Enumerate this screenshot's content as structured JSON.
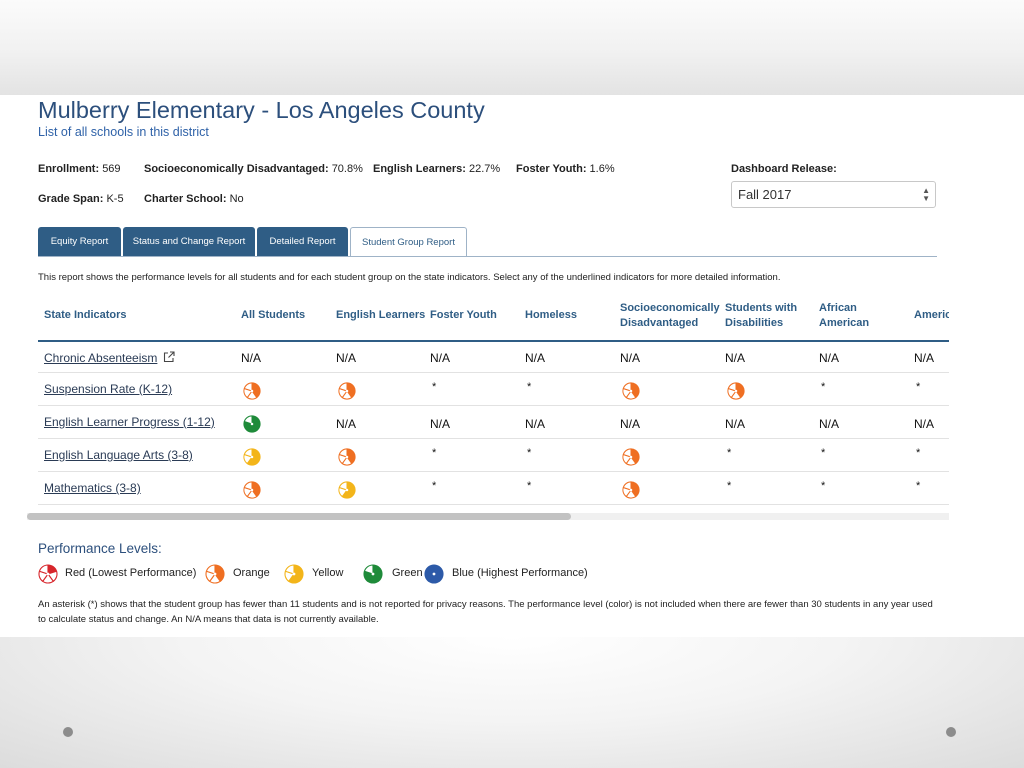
{
  "school": {
    "title": "Mulberry Elementary - Los Angeles County",
    "district_link": "List of all schools in this district"
  },
  "facts": {
    "enrollment_label": "Enrollment:",
    "enrollment_value": "569",
    "sed_label": "Socioeconomically Disadvantaged:",
    "sed_value": "70.8%",
    "el_label": "English Learners:",
    "el_value": "22.7%",
    "foster_label": "Foster Youth:",
    "foster_value": "1.6%",
    "grade_span_label": "Grade Span:",
    "grade_span_value": "K-5",
    "charter_label": "Charter School:",
    "charter_value": "No"
  },
  "release": {
    "label": "Dashboard Release:",
    "selected": "Fall 2017"
  },
  "tabs": [
    {
      "label": "Equity Report"
    },
    {
      "label": "Status and Change Report"
    },
    {
      "label": "Detailed Report"
    },
    {
      "label": "Student Group Report"
    }
  ],
  "intro": "This report shows the performance levels for all students and for each student group on the state indicators. Select any of the underlined indicators for more detailed information.",
  "table": {
    "headers": [
      "State Indicators",
      "All Students",
      "English Learners",
      "Foster Youth",
      "Homeless",
      "Socioeconomically Disadvantaged",
      "Students with Disabilities",
      "African American",
      "Americ"
    ],
    "rows": [
      {
        "indicator": "Chronic Absenteeism",
        "cells": [
          "N/A",
          "N/A",
          "N/A",
          "N/A",
          "N/A",
          "N/A",
          "N/A",
          "N/A"
        ]
      },
      {
        "indicator": "Suspension Rate (K-12)",
        "cells": [
          "orange",
          "orange",
          "*",
          "*",
          "orange",
          "orange",
          "*",
          "*"
        ]
      },
      {
        "indicator": "English Learner Progress (1-12)",
        "cells": [
          "green",
          "N/A",
          "N/A",
          "N/A",
          "N/A",
          "N/A",
          "N/A",
          "N/A"
        ]
      },
      {
        "indicator": "English Language Arts (3-8)",
        "cells": [
          "yellow",
          "orange",
          "*",
          "*",
          "orange",
          "*",
          "*",
          "*"
        ]
      },
      {
        "indicator": "Mathematics (3-8)",
        "cells": [
          "orange",
          "yellow",
          "*",
          "*",
          "orange",
          "*",
          "*",
          "*"
        ]
      }
    ]
  },
  "performance": {
    "title": "Performance Levels:",
    "levels": [
      {
        "key": "red",
        "label": "Red (Lowest Performance)",
        "color": "#d7262c",
        "fill_segments": 1
      },
      {
        "key": "orange",
        "label": "Orange",
        "color": "#ef6f22",
        "fill_segments": 2
      },
      {
        "key": "yellow",
        "label": "Yellow",
        "color": "#f3b51a",
        "fill_segments": 3
      },
      {
        "key": "green",
        "label": "Green",
        "color": "#1f8b3a",
        "fill_segments": 4
      },
      {
        "key": "blue",
        "label": "Blue (Highest Performance)",
        "color": "#2d5aa8",
        "fill_segments": 5
      }
    ]
  },
  "footnote": "An asterisk (*) shows that the student group has fewer than 11 students and is not reported for privacy reasons. The performance level (color) is not included when there are fewer than 30 students in any year used to calculate status and change. An N/A means that data is not currently available.",
  "icons": {
    "external_link": "external-link-icon",
    "select_arrows": "select-arrows-icon"
  },
  "colors": {
    "heading": "#2c4f7c",
    "tab": "#2f5d85",
    "link": "#2f62a8"
  }
}
